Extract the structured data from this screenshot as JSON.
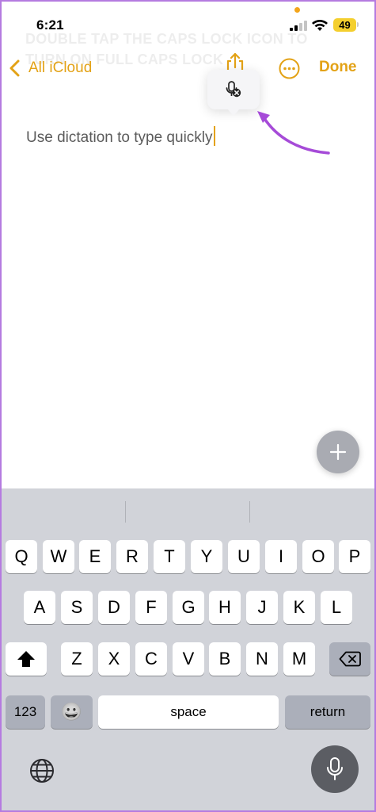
{
  "status_bar": {
    "time": "6:21",
    "battery": "49",
    "icons": [
      "orange-dot-icon",
      "signal-icon",
      "wifi-icon",
      "battery-icon"
    ]
  },
  "ghost_text": "DOUBLE TAP THE CAPS LOCK ICON TO TURN ON FULL CAPS LOCK",
  "nav": {
    "back_label": "All iCloud",
    "done_label": "Done",
    "accent_color": "#e3a216"
  },
  "note": {
    "text": "Use dictation to type quickly"
  },
  "annotation": {
    "arrow_color": "#a64bd8"
  },
  "keyboard": {
    "row1": [
      "Q",
      "W",
      "E",
      "R",
      "T",
      "Y",
      "U",
      "I",
      "O",
      "P"
    ],
    "row2": [
      "A",
      "S",
      "D",
      "F",
      "G",
      "H",
      "J",
      "K",
      "L"
    ],
    "row3": [
      "Z",
      "X",
      "C",
      "V",
      "B",
      "N",
      "M"
    ],
    "numbers_label": "123",
    "space_label": "space",
    "return_label": "return",
    "emoji": "😀"
  }
}
